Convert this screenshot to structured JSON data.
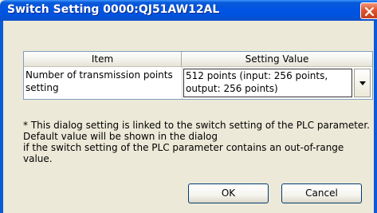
{
  "window": {
    "title": "Switch Setting 0000:QJ51AW12AL"
  },
  "table": {
    "headers": {
      "item": "Item",
      "value": "Setting Value"
    },
    "rows": [
      {
        "item": "Number of transmission points\nsetting",
        "value": "512 points (input: 256 points,\noutput: 256 points)"
      }
    ]
  },
  "note": "* This dialog setting is linked to the switch setting of the PLC parameter.\nDefault value will be shown in the dialog\nif the switch setting of the PLC parameter contains an out-of-range\nvalue.",
  "buttons": {
    "ok": "OK",
    "cancel": "Cancel"
  },
  "icons": {
    "close": "close-icon",
    "dropdown": "chevron-down-icon"
  }
}
